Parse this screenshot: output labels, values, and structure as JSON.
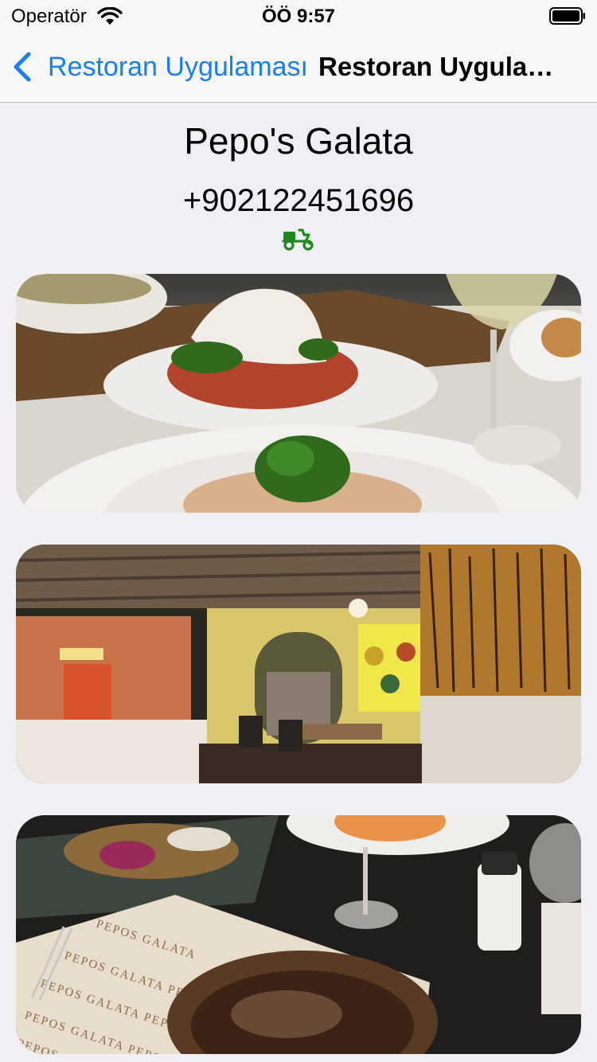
{
  "status_bar": {
    "carrier": "Operatör",
    "time": "ÖÖ 9:57",
    "icons": [
      "wifi-icon",
      "battery-icon"
    ]
  },
  "nav": {
    "back_label": "Restoran Uygulaması",
    "title": "Restoran Uygulaması",
    "back_icon": "chevron-left-icon"
  },
  "restaurant": {
    "name": "Pepo's Galata",
    "phone": "+902122451696",
    "delivery_icon": "scooter-icon",
    "delivery_color": "#1e8a1e"
  },
  "photos": [
    {
      "subject": "pasta dish with parsley"
    },
    {
      "subject": "restaurant interior"
    },
    {
      "subject": "table with dishes and Pepo's Galata menu",
      "menu_text": "PEPOS GALATA"
    }
  ],
  "colors": {
    "accent": "#1a7ef7",
    "background": "#efeff4",
    "bar": "#f7f7f7"
  }
}
